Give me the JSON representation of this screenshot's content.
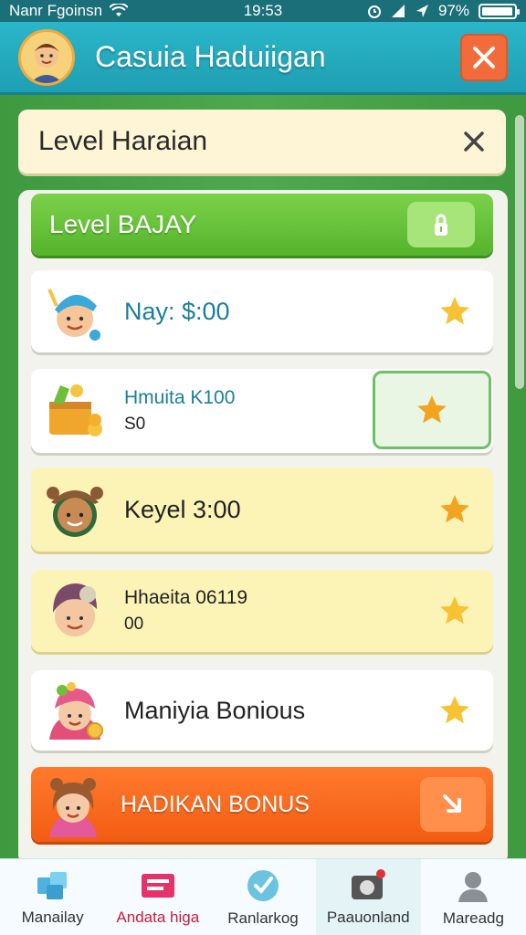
{
  "status_bar": {
    "carrier": "Nanr Fgoinsn",
    "time": "19:53",
    "battery_percent": "97%",
    "battery_level": 0.97
  },
  "header": {
    "title": "Casuia Haduiigan",
    "avatar_icon": "boy-avatar-icon",
    "close_icon": "close-icon"
  },
  "subheader": {
    "title": "Level Haraian",
    "close_icon": "close-icon"
  },
  "banner": {
    "title": "Level BAJAY",
    "lock_icon": "lock-icon"
  },
  "rewards": [
    {
      "icon": "kid-with-cap-icon",
      "line1": "Nay: $:00",
      "line2": "",
      "style": "white"
    },
    {
      "icon": "treasure-chest-icon",
      "line1": "Hmuita K100",
      "line2": "S0",
      "style": "white"
    },
    {
      "icon": "kid-with-hat-icon",
      "line1": "Keyel 3:00",
      "line2": "",
      "style": "yellow"
    },
    {
      "icon": "girl-with-beanie-icon",
      "line1": "Hhaeita 06119",
      "line2": "00",
      "style": "yellow"
    },
    {
      "icon": "girl-with-coin-icon",
      "line1": "Maniyia Bonious",
      "line2": "",
      "style": "white"
    }
  ],
  "bonus": {
    "label": "HADIKAN BONUS",
    "icon": "girl-avatar-icon",
    "button_icon": "arrow-icon"
  },
  "nav": [
    {
      "label": "Manailay",
      "icon": "cubes-icon",
      "active": false
    },
    {
      "label": "Andata higa",
      "icon": "ticket-icon",
      "active": false
    },
    {
      "label": "Ranlarkog",
      "icon": "check-badge-icon",
      "active": false
    },
    {
      "label": "Paauonland",
      "icon": "camera-icon",
      "active": true
    },
    {
      "label": "Mareadg",
      "icon": "profile-icon",
      "active": false
    }
  ],
  "colors": {
    "header": "#1f9fb3",
    "banner": "#56b32c",
    "bonus": "#f25c12",
    "star": "#f7b32b",
    "close_button": "#f26b3a"
  }
}
